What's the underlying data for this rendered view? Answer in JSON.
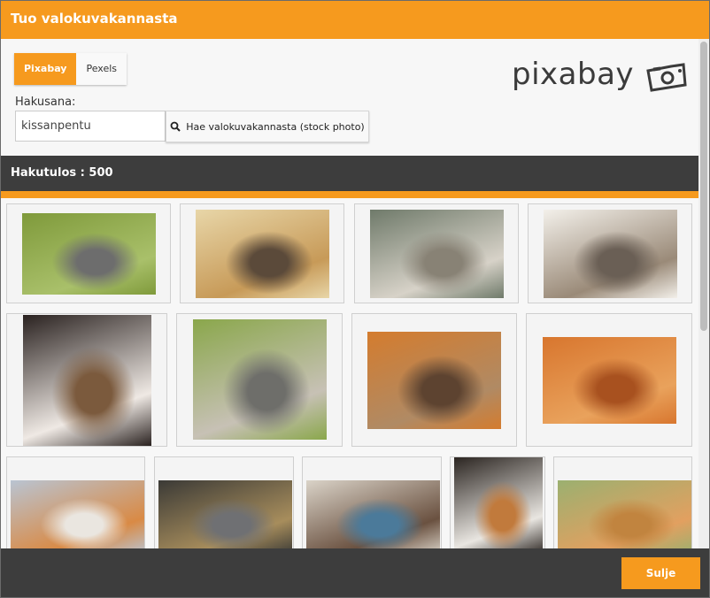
{
  "dialog": {
    "title": "Tuo valokuvakannasta"
  },
  "tabs": [
    {
      "label": "Pixabay",
      "active": true
    },
    {
      "label": "Pexels",
      "active": false
    }
  ],
  "logo": {
    "text": "pixabay",
    "icon": "camera-icon"
  },
  "search": {
    "label": "Hakusana:",
    "value": "kissanpentu",
    "button_label": "Hae valokuvakannasta (stock photo)",
    "button_icon": "search-icon"
  },
  "results": {
    "label": "Hakutulos : 500"
  },
  "images": [
    {
      "subject": "kitten-on-grass",
      "colors": [
        "#7f9a3b",
        "#a9c06a",
        "#6d6d6d"
      ]
    },
    {
      "subject": "lion-cub-on-tree",
      "colors": [
        "#e8d6a8",
        "#c79a58",
        "#5b4a3a"
      ]
    },
    {
      "subject": "woman-with-white-tiger",
      "colors": [
        "#6f7a6a",
        "#d7d2c8",
        "#888275"
      ]
    },
    {
      "subject": "tabby-kitten-lying",
      "colors": [
        "#f3f0ea",
        "#9a8a78",
        "#6a5f55"
      ]
    },
    {
      "subject": "white-kitten-blue-eyes",
      "colors": [
        "#2a2220",
        "#efe9e4",
        "#7b5a3d"
      ]
    },
    {
      "subject": "two-kittens-in-garden",
      "colors": [
        "#8aa74b",
        "#c7c1b5",
        "#6e6e6a"
      ]
    },
    {
      "subject": "ginger-cat-in-basket",
      "colors": [
        "#d47c2e",
        "#b08a64",
        "#5d4330"
      ]
    },
    {
      "subject": "ginger-cat-closeup",
      "colors": [
        "#d8762e",
        "#e9a25c",
        "#a8511f"
      ]
    },
    {
      "subject": "ginger-kitten",
      "colors": [
        "#b9c4d2",
        "#d98a45",
        "#eae6e0"
      ]
    },
    {
      "subject": "three-kittens-in-straw",
      "colors": [
        "#3b3a36",
        "#a78d5c",
        "#6f7073"
      ]
    },
    {
      "subject": "ragdoll-cat",
      "colors": [
        "#dad3c8",
        "#6a5140",
        "#4b7a9a"
      ]
    },
    {
      "subject": "calico-cat-yawning",
      "colors": [
        "#2b2521",
        "#e9e6e1",
        "#c17a3c"
      ]
    },
    {
      "subject": "ginger-kittens-sleeping",
      "colors": [
        "#9bb070",
        "#e2a060",
        "#c1843f"
      ]
    }
  ],
  "footer": {
    "close_label": "Sulje"
  }
}
